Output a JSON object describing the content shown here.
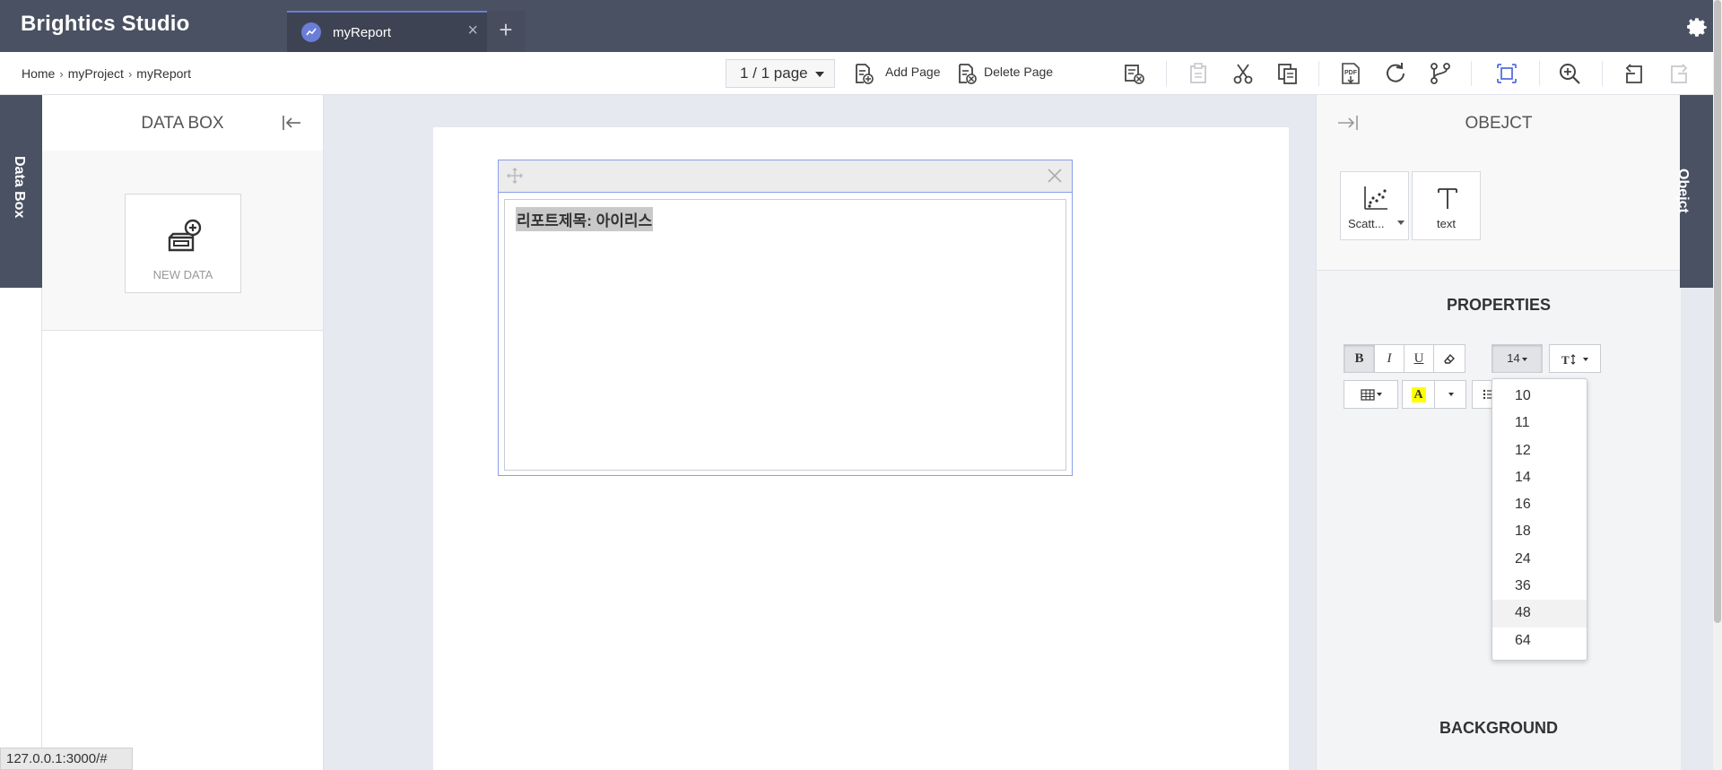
{
  "app": {
    "title": "Brightics Studio"
  },
  "tabs": [
    {
      "label": "myReport",
      "close": "×"
    }
  ],
  "tab_add": "+",
  "breadcrumb": [
    "Home",
    "myProject",
    "myReport"
  ],
  "page_selector": {
    "value": "1 / 1 page"
  },
  "toolbar": {
    "add_page": "Add Page",
    "delete_page": "Delete Page"
  },
  "left_vertical_tab": "Data Box",
  "right_vertical_tab": "Obejct",
  "databox": {
    "title": "DATA BOX",
    "new_data": "NEW DATA"
  },
  "textbox": {
    "content": "리포트제목: 아이리스"
  },
  "object_panel": {
    "title": "OBEJCT",
    "items": [
      {
        "label": "Scatt..."
      },
      {
        "label": "text"
      }
    ]
  },
  "properties": {
    "title": "PROPERTIES",
    "bold": "B",
    "italic": "I",
    "underline": "U",
    "font_size": "14",
    "background_title": "BACKGROUND"
  },
  "font_size_menu": {
    "options": [
      "10",
      "11",
      "12",
      "14",
      "16",
      "18",
      "24",
      "36",
      "48",
      "64"
    ],
    "hovered": "48"
  },
  "status_url": "127.0.0.1:3000/#",
  "colors": {
    "topbar": "#4a5162",
    "accent": "#6b7dd6",
    "highlight_yellow": "#ffff00"
  }
}
